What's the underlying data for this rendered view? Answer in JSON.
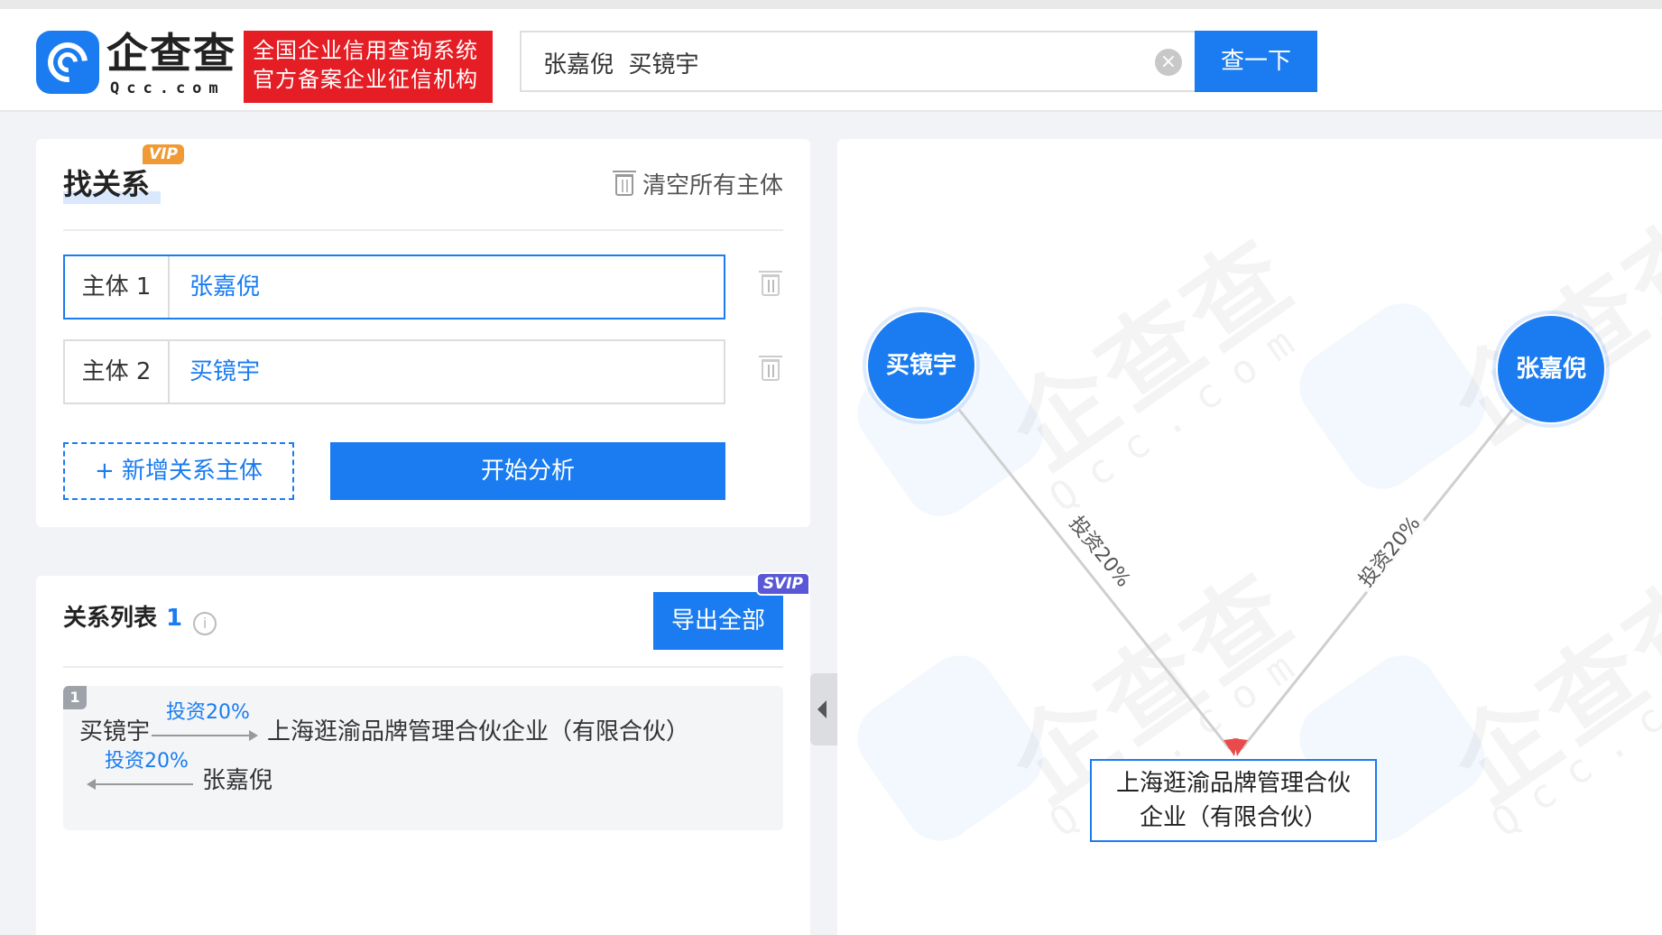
{
  "header": {
    "brand_name": "企查查",
    "brand_domain": "Qcc.com",
    "badge_line1": "全国企业信用查询系统",
    "badge_line2": "官方备案企业征信机构",
    "search_value": "张嘉倪  买镜宇",
    "clear_glyph": "×",
    "search_button": "查一下"
  },
  "find": {
    "vip_label": "VIP",
    "title": "找关系",
    "clear_all": "清空所有主体",
    "subjects": [
      {
        "label": "主体 1",
        "value": "张嘉倪"
      },
      {
        "label": "主体 2",
        "value": "买镜宇"
      }
    ],
    "add_subject": "+ 新增关系主体",
    "start_analysis": "开始分析"
  },
  "relations": {
    "title": "关系列表",
    "count": "1",
    "info_glyph": "i",
    "svip_label": "SVIP",
    "export_all": "导出全部",
    "items": [
      {
        "index": "1",
        "from": "买镜宇",
        "edge1": "投资20%",
        "company": "上海逛渝品牌管理合伙企业（有限合伙）",
        "edge2": "投资20%",
        "to": "张嘉倪"
      }
    ]
  },
  "graph": {
    "watermark_text": "企查查",
    "watermark_domain": "Qcc.com",
    "nodes": [
      {
        "name": "买镜宇",
        "type": "person"
      },
      {
        "name": "张嘉倪",
        "type": "person"
      }
    ],
    "company_line1": "上海逛渝品牌管理合伙",
    "company_line2": "企业（有限合伙）",
    "edges": [
      {
        "label": "投资20%"
      },
      {
        "label": "投资20%"
      }
    ],
    "colors": {
      "node": "#1a7cf0",
      "edge": "#cfcfcf",
      "arrow": "#e94b4b"
    }
  }
}
